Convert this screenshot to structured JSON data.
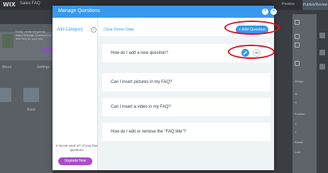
{
  "editor": {
    "logo": "WIX",
    "page": "Sales FAQ",
    "preview": "Preview",
    "publish": "Publish/Review",
    "left_panel": {
      "promo_text": "Easily create frequently asked Manage Questions to add FAQ for your site.",
      "tab_about": "About",
      "tab_settings": "Settings",
      "layout_label": "Basic"
    },
    "right_panel": {
      "labels": [
        "Design",
        "W",
        "H",
        "Position",
        "X",
        "Y",
        "Rotate",
        "Lock"
      ]
    }
  },
  "modal": {
    "title": "Manage Questions",
    "help_label": "?",
    "close_label": "×",
    "sidebar": {
      "add_category": "Add Category",
      "info_icon": "i",
      "quota_text": "You've used 4/7 of your free questions",
      "upgrade_button": "Upgrade Now"
    },
    "main": {
      "clear_demo": "Clear Demo Data",
      "add_question": "+ Add Question",
      "questions": [
        {
          "text": "How do I add a new question?"
        },
        {
          "text": "Can I insert pictures in my FAQ?"
        },
        {
          "text": "Can I insert a video in my FAQ?"
        },
        {
          "text": "How do I edit or remove the \"FAQ title\"?"
        }
      ]
    }
  },
  "colors": {
    "accent": "#3899ec",
    "upgrade": "#aa4dc8",
    "highlight": "#e0101c"
  }
}
